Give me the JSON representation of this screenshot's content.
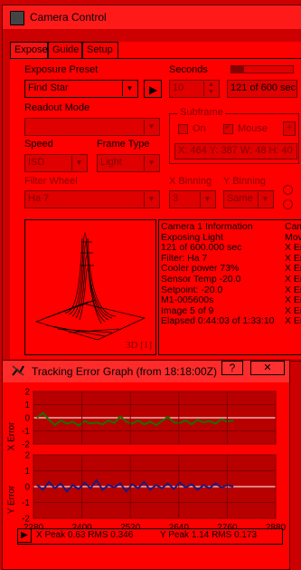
{
  "camera_window": {
    "title": "Camera Control",
    "tabs": [
      "Expose",
      "Guide",
      "Setup"
    ],
    "exposure_preset_label": "Exposure Preset",
    "exposure_preset_value": "Find Star",
    "seconds_label": "Seconds",
    "seconds_value": "10",
    "progress_text": "121 of 600 sec",
    "progress_fraction": 0.2,
    "readout_mode_label": "Readout Mode",
    "readout_mode_value": "",
    "subframe_label": "Subframe",
    "subframe_on_label": "On",
    "subframe_mouse_label": "Mouse",
    "subframe_coords": "X: 464 Y: 387 W: 48 H: 40",
    "speed_label": "Speed",
    "speed_value": "ISD",
    "frame_type_label": "Frame Type",
    "frame_type_value": "Light",
    "filter_wheel_label": "Filter Wheel",
    "filter_wheel_value": "Ha 7",
    "x_binning_label": "X Binning",
    "x_binning_value": "3",
    "y_binning_label": "Y Binning",
    "y_binning_value": "Same",
    "profile_label": "3D [1]",
    "camera_info": [
      "Camera 1 Information",
      "Exposing Light",
      "121 of 600.000 sec",
      "Filter: Ha 7",
      "Cooler power 73%",
      "Sensor Temp -20.0",
      "Setpoint: -20.0",
      "M1-005600s",
      "Image 5 of 9",
      "Elapsed 0:44:03 of 1:33:10"
    ],
    "camera_info_2": [
      "Cam",
      "Mov",
      "X Er",
      "X Er",
      "X Er",
      "X Er",
      "X Er",
      "X Er",
      "X Er",
      "X Er"
    ]
  },
  "tracking_window": {
    "title": "Tracking Error Graph (from 18:18:00Z)",
    "help_label": "?",
    "close_label": "✕",
    "x_axis_label": "X Error",
    "y_axis_label": "Y Error",
    "footer_x": "X Peak 0.63   RMS 0.346",
    "footer_y": "Y Peak 1.14   RMS 0.173",
    "chart_data": [
      {
        "type": "line",
        "ylabel": "X Error",
        "ylim": [
          -2,
          2
        ],
        "yticks": [
          "2",
          "1",
          "0",
          "-1",
          "-2"
        ],
        "xlim": [
          2280,
          2880
        ],
        "series": [
          {
            "values": [
              0.0,
              0.35,
              -0.15,
              -0.55,
              -0.2,
              -0.45,
              -0.3,
              -0.6,
              -0.25,
              -0.45,
              -0.35,
              -0.5,
              -0.2,
              -0.4,
              0.1,
              -0.3,
              -0.45,
              -0.2,
              -0.5,
              -0.3,
              -0.55,
              -0.25,
              0.05,
              -0.35,
              -0.4,
              -0.2,
              -0.5,
              -0.15,
              -0.35,
              -0.25,
              -0.45,
              -0.1,
              -0.3,
              -0.2
            ]
          }
        ]
      },
      {
        "type": "line",
        "ylabel": "Y Error",
        "ylim": [
          -2,
          2
        ],
        "yticks": [
          "2",
          "1",
          "0",
          "-1",
          "-2"
        ],
        "xlim": [
          2280,
          2880
        ],
        "xticks": [
          "2280",
          "2400",
          "2520",
          "2640",
          "2760",
          "2880"
        ],
        "series": [
          {
            "values": [
              0.1,
              -0.2,
              0.3,
              -0.1,
              0.2,
              -0.3,
              0.1,
              -0.15,
              0.25,
              -0.1,
              0.4,
              -0.2,
              0.1,
              -0.05,
              0.2,
              -0.3,
              0.15,
              -0.1,
              0.3,
              -0.2,
              0.1,
              -0.1,
              0.2,
              -0.15,
              0.25,
              -0.05,
              0.15,
              -0.2,
              0.1,
              -0.1,
              0.2,
              -0.05,
              0.1,
              0.0
            ]
          }
        ]
      }
    ]
  }
}
